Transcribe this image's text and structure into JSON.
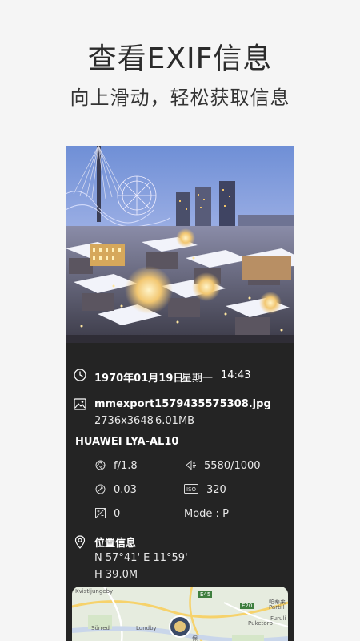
{
  "header": {
    "title": "查看EXIF信息",
    "subtitle": "向上滑动，轻松获取信息"
  },
  "exif": {
    "date": "1970年01月19日",
    "weekday": "星期一",
    "time": "14:43",
    "filename": "mmexport1579435575308.jpg",
    "resolution": "2736x3648",
    "filesize": "6.01MB",
    "device": "HUAWEI LYA-AL10",
    "aperture": "f/1.8",
    "shutter": "5580/1000",
    "focal": "0.03",
    "iso": "320",
    "exposure": "0",
    "mode": "Mode : P"
  },
  "location": {
    "title": "位置信息",
    "coords": "N 57°41'  E 11°59'",
    "altitude": "H 39.0M"
  },
  "map": {
    "labels": [
      "Kvistljungeby",
      "Sörred",
      "Lundby",
      "Puketorp",
      "帕蒂莱",
      "Partill",
      "Furuli",
      "E45",
      "E20",
      "保"
    ]
  },
  "icons": {
    "clock": "clock-icon",
    "image": "image-icon",
    "aperture": "aperture-icon",
    "shutter": "shutter-icon",
    "focal": "focal-icon",
    "iso": "iso-icon",
    "exposure": "exposure-icon",
    "location": "location-pin-icon"
  },
  "colors": {
    "background": "#f5f5f5",
    "card": "#242424",
    "text_dark": "#2b2b2b"
  }
}
